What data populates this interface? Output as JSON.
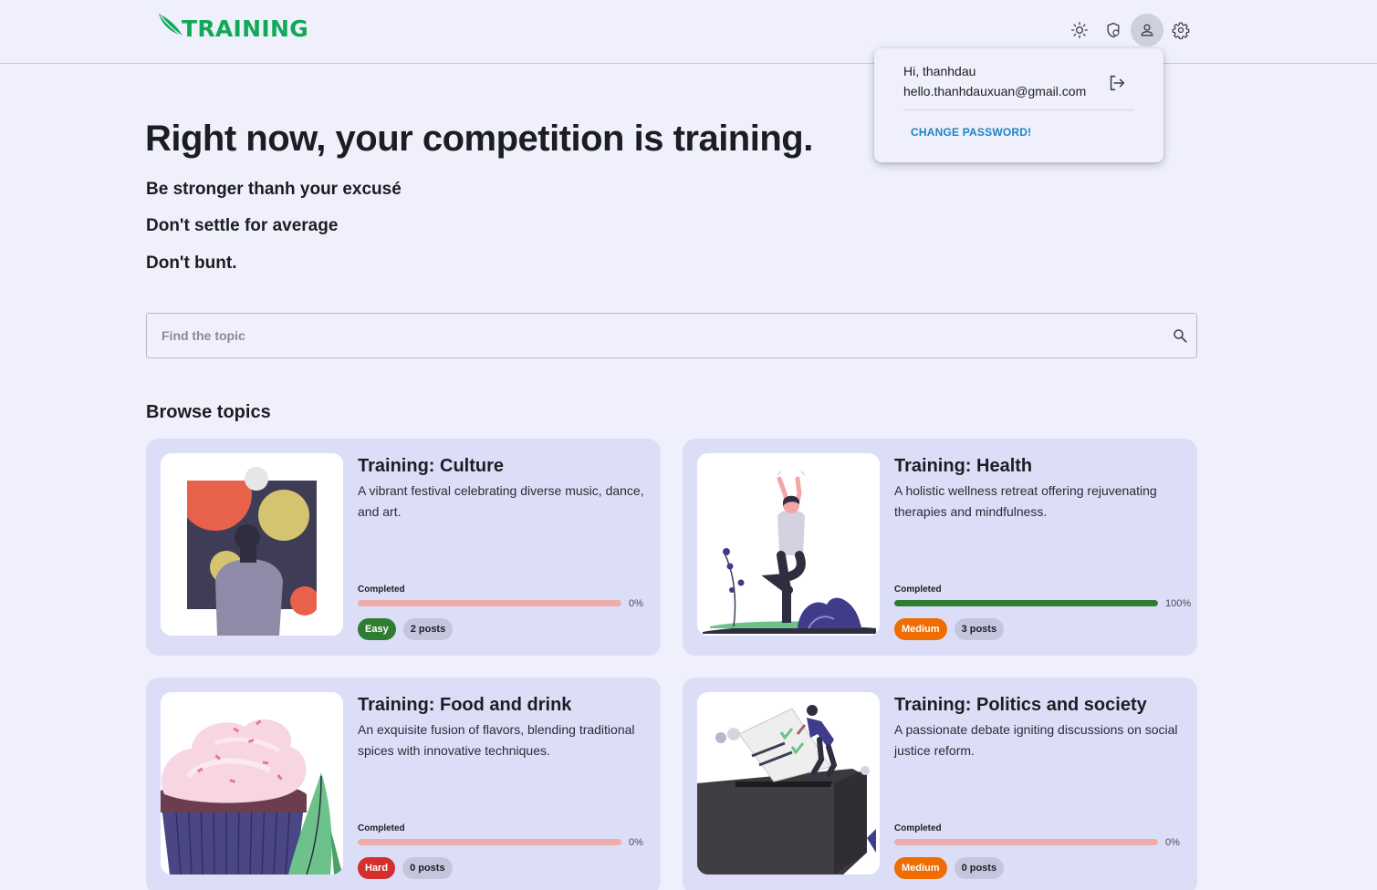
{
  "header": {
    "logo_text": "TRAINING",
    "icons": [
      "sun-icon",
      "theme-shield-icon",
      "user-icon",
      "gear-icon"
    ]
  },
  "user_menu": {
    "greeting": "Hi, thanhdau",
    "email": "hello.thanhdauxuan@gmail.com",
    "change_password": "CHANGE PASSWORD!"
  },
  "hero": {
    "title": "Right now, your competition is training.",
    "lines": [
      "Be stronger thanh your excusé",
      "Don't settle for average",
      "Don't bunt."
    ]
  },
  "search": {
    "placeholder": "Find the topic"
  },
  "browse": {
    "heading": "Browse topics",
    "completed_label": "Completed",
    "topics": [
      {
        "title": "Training: Culture",
        "description": "A vibrant festival celebrating diverse music, dance, and art.",
        "progress_text": "0%",
        "progress": 0,
        "level": "Easy",
        "level_color": "#2f7d32",
        "posts": "2 posts",
        "image": "culture-illustration"
      },
      {
        "title": "Training: Health",
        "description": "A holistic wellness retreat offering rejuvenating therapies and mindfulness.",
        "progress_text": "100%",
        "progress": 100,
        "level": "Medium",
        "level_color": "#ee6c00",
        "posts": "3 posts",
        "image": "yoga-illustration"
      },
      {
        "title": "Training: Food and drink",
        "description": "An exquisite fusion of flavors, blending traditional spices with innovative techniques.",
        "progress_text": "0%",
        "progress": 0,
        "level": "Hard",
        "level_color": "#d32f2f",
        "posts": "0 posts",
        "image": "cupcake-illustration"
      },
      {
        "title": "Training: Politics and society",
        "description": "A passionate debate igniting discussions on social justice reform.",
        "progress_text": "0%",
        "progress": 0,
        "level": "Medium",
        "level_color": "#ee6c00",
        "posts": "0 posts",
        "image": "ballot-illustration"
      }
    ]
  }
}
